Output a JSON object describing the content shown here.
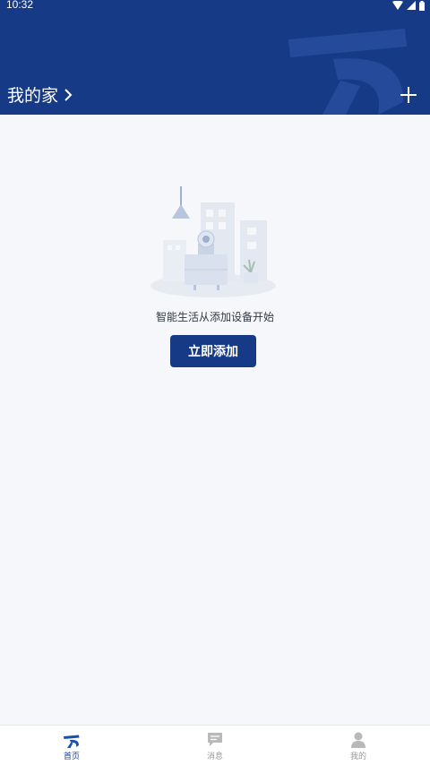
{
  "status_bar": {
    "time": "10:32"
  },
  "header": {
    "home_name": "我的家"
  },
  "main": {
    "empty_message": "智能生活从添加设备开始",
    "add_button_label": "立即添加"
  },
  "tabs": [
    {
      "label": "首页",
      "icon": "home-logo-icon",
      "active": true
    },
    {
      "label": "消息",
      "icon": "message-icon",
      "active": false
    },
    {
      "label": "我的",
      "icon": "profile-icon",
      "active": false
    }
  ],
  "colors": {
    "primary": "#163a86",
    "background": "#f5f7fa",
    "tab_inactive": "#9a9a9a"
  }
}
